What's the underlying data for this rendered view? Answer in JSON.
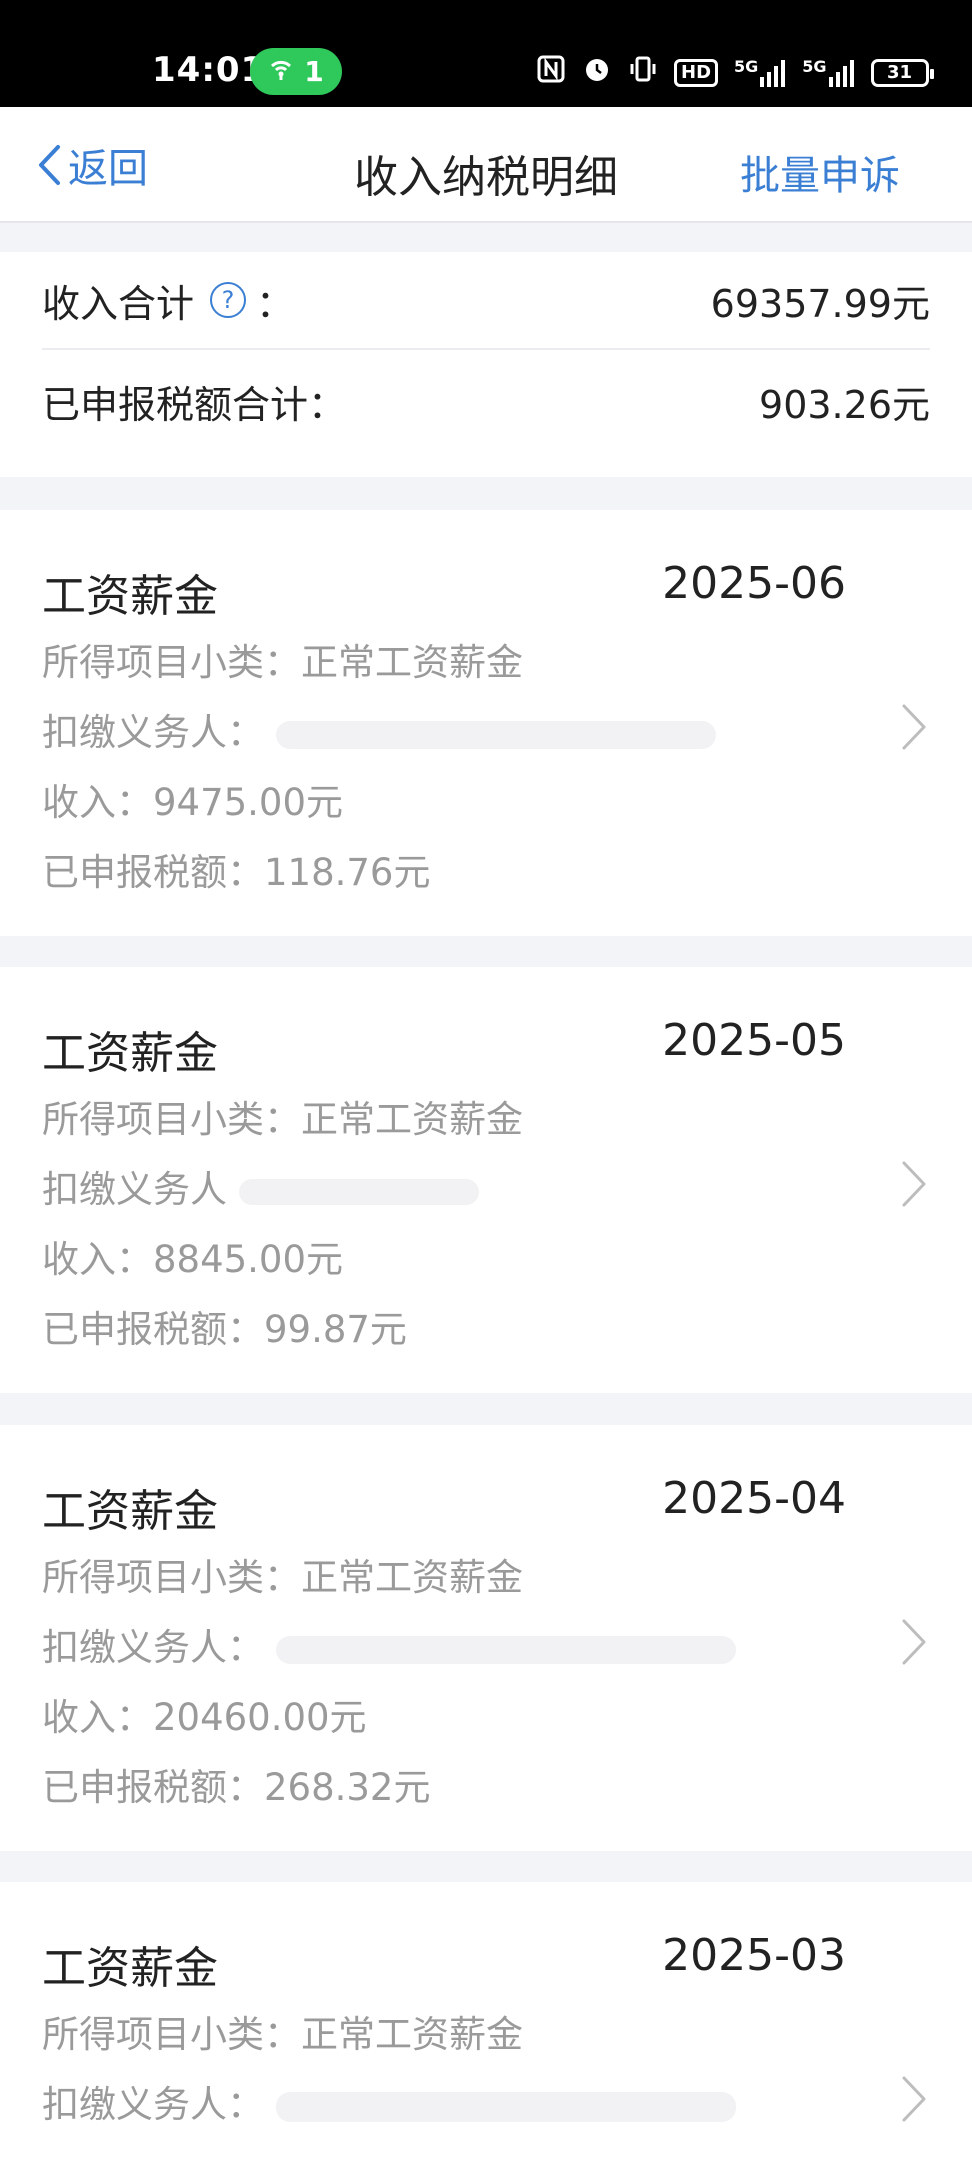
{
  "status_bar": {
    "time": "14:01",
    "hotspot_count": "1",
    "network_1": "5G",
    "network_2": "5G",
    "hd_label": "HD",
    "battery": "31"
  },
  "nav": {
    "back_label": "返回",
    "title": "收入纳税明细",
    "action_label": "批量申诉"
  },
  "summary": {
    "income_label": "收入合计",
    "income_colon": "：",
    "income_value": "69357.99元",
    "tax_label": "已申报税额合计：",
    "tax_value": "903.26元"
  },
  "records": [
    {
      "title": "工资薪金",
      "date": "2025-06",
      "subcategory": "所得项目小类：正常工资薪金",
      "withholder_label": "扣缴义务人：",
      "income": "收入：9475.00元",
      "tax": "已申报税额：118.76元"
    },
    {
      "title": "工资薪金",
      "date": "2025-05",
      "subcategory": "所得项目小类：正常工资薪金",
      "withholder_label": "扣缴义务人",
      "income": "收入：8845.00元",
      "tax": "已申报税额：99.87元"
    },
    {
      "title": "工资薪金",
      "date": "2025-04",
      "subcategory": "所得项目小类：正常工资薪金",
      "withholder_label": "扣缴义务人：",
      "income": "收入：20460.00元",
      "tax": "已申报税额：268.32元"
    },
    {
      "title": "工资薪金",
      "date": "2025-03",
      "subcategory": "所得项目小类：正常工资薪金",
      "withholder_label": "扣缴义务人：",
      "income": "",
      "tax": ""
    }
  ],
  "colors": {
    "accent": "#3b7fd4",
    "hotspot": "#2fc85a",
    "page_bg": "#f3f4f8",
    "muted_text": "#9a9a9a"
  },
  "icons": [
    "back-chevron-icon",
    "help-icon",
    "chevron-right-icon",
    "hotspot-icon",
    "nfc-icon",
    "alarm-icon",
    "vibrate-icon",
    "signal-icon",
    "battery-icon"
  ]
}
